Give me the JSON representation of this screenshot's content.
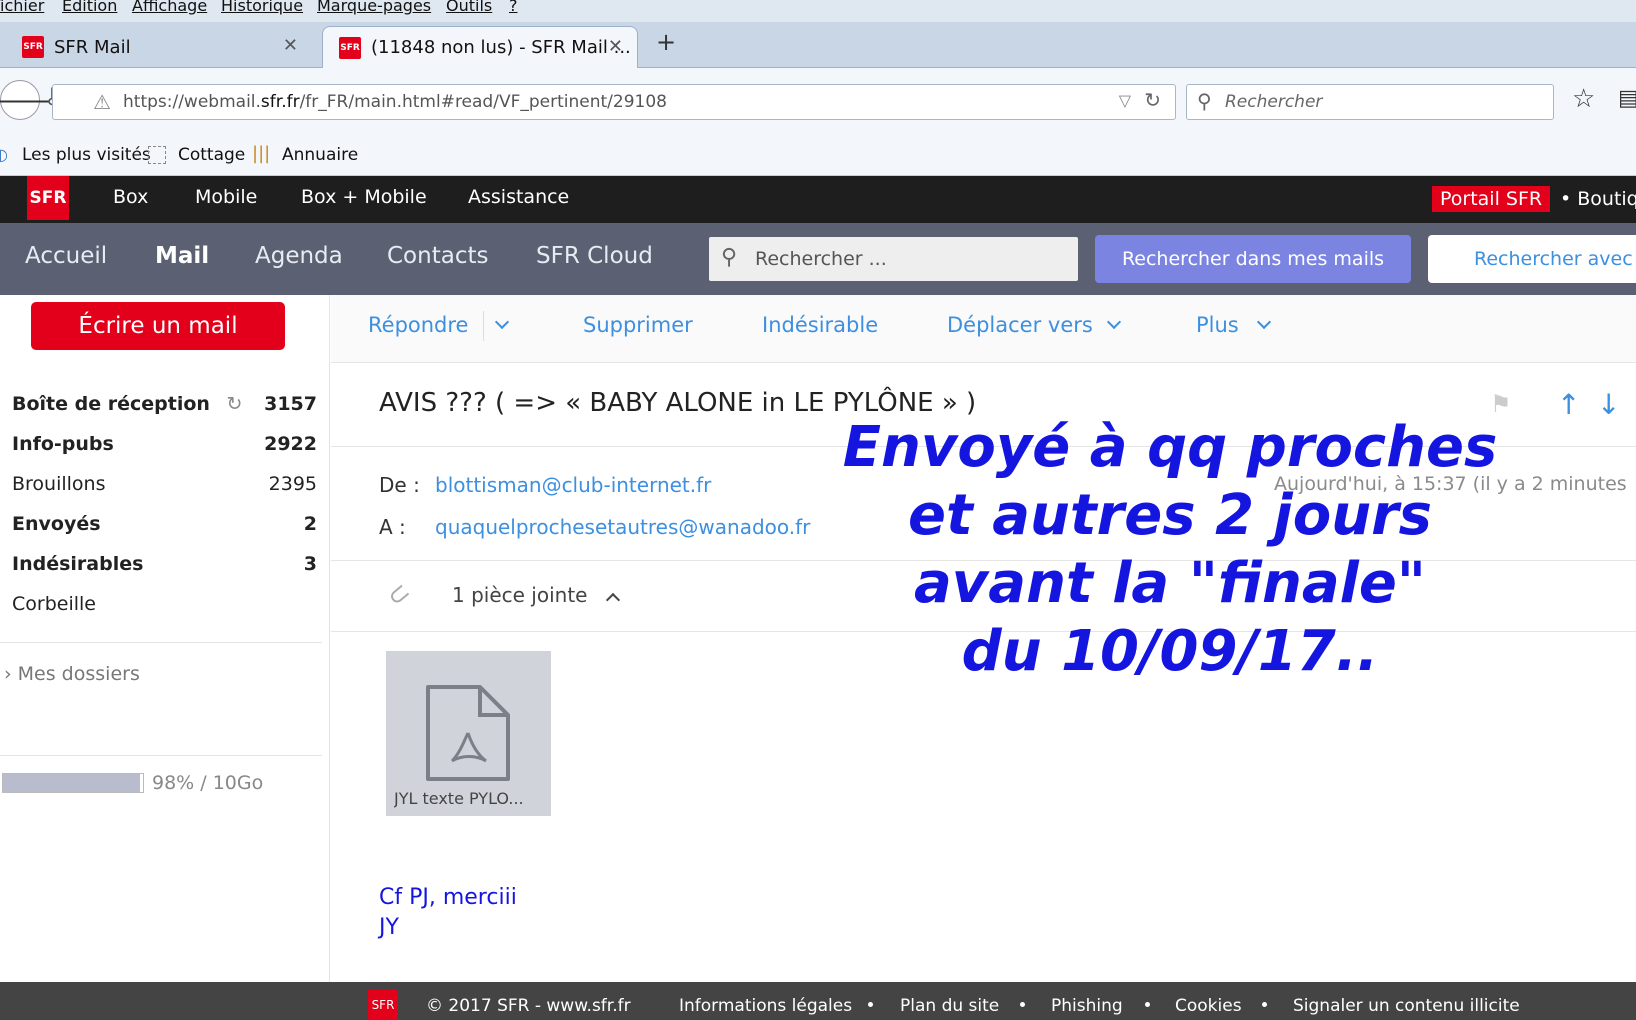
{
  "browser": {
    "menu": [
      "Fichier",
      "Edition",
      "Affichage",
      "Historique",
      "Marque-pages",
      "Outils",
      "?"
    ],
    "tabs": [
      {
        "label": "SFR Mail"
      },
      {
        "label": "(11848 non lus) - SFR Mail ..."
      }
    ],
    "new_tab": "+",
    "url_prefix": "https://webmail.",
    "url_domain": "sfr.fr",
    "url_rest": "/fr_FR/main.html#read/VF_pertinent/29108",
    "search_placeholder": "Rechercher",
    "bookmarks": [
      "Les plus visités",
      "Cottage",
      "Annuaire"
    ]
  },
  "sfr_bar": {
    "logo": "SFR",
    "items": [
      "Box",
      "Mobile",
      "Box + Mobile",
      "Assistance"
    ],
    "portal": "Portail SFR",
    "boutique": "• Boutique"
  },
  "mail_nav": {
    "items": [
      "Accueil",
      "Mail",
      "Agenda",
      "Contacts",
      "SFR Cloud"
    ],
    "active": "Mail",
    "search_placeholder": "Rechercher ...",
    "search_btn": "Rechercher dans mes mails",
    "search_btn2": "Rechercher avec G"
  },
  "sidebar": {
    "write_btn": "Écrire un mail",
    "folders": [
      {
        "name": "Boîte de réception",
        "count": "3157",
        "bold": true
      },
      {
        "name": "Info-pubs",
        "count": "2922",
        "bold": true
      },
      {
        "name": "Brouillons",
        "count": "2395",
        "bold": false
      },
      {
        "name": "Envoyés",
        "count": "2",
        "bold": true
      },
      {
        "name": "Indésirables",
        "count": "3",
        "bold": true
      },
      {
        "name": "Corbeille",
        "count": "",
        "bold": false
      }
    ],
    "my_folders": "Mes dossiers",
    "quota_text": "98% / 10Go",
    "quota_fraction": 0.98
  },
  "toolbar": {
    "reply": "Répondre",
    "delete": "Supprimer",
    "spam": "Indésirable",
    "move": "Déplacer vers",
    "more": "Plus"
  },
  "message": {
    "subject": "AVIS ??? ( => « BABY ALONE in LE PYLÔNE » )",
    "from_label": "De :",
    "from": "blottisman@club-internet.fr",
    "to_label": "A :",
    "to": "quaquelprochesetautres@wanadoo.fr",
    "date": "Aujourd'hui, à 15:37 (il y a 2 minutes",
    "attachments_label": "1 pièce jointe",
    "attachment_name": "JYL texte PYLO...",
    "body_line1": "Cf PJ, merciii",
    "body_line2": "JY"
  },
  "overlay_text": [
    "Envoyé à qq proches",
    "et autres 2 jours",
    "avant la \"finale\"",
    "du 10/09/17.."
  ],
  "footer": {
    "logo": "SFR",
    "copyright": "© 2017 SFR - www.sfr.fr",
    "links": [
      "Informations légales",
      "Plan du site",
      "Phishing",
      "Cookies",
      "Signaler un contenu illicite"
    ]
  },
  "colors": {
    "sfr_red": "#e2001a",
    "link_blue": "#3d8fe0",
    "overlay_blue": "#1515e0",
    "mail_nav_bg": "#5b6173"
  }
}
